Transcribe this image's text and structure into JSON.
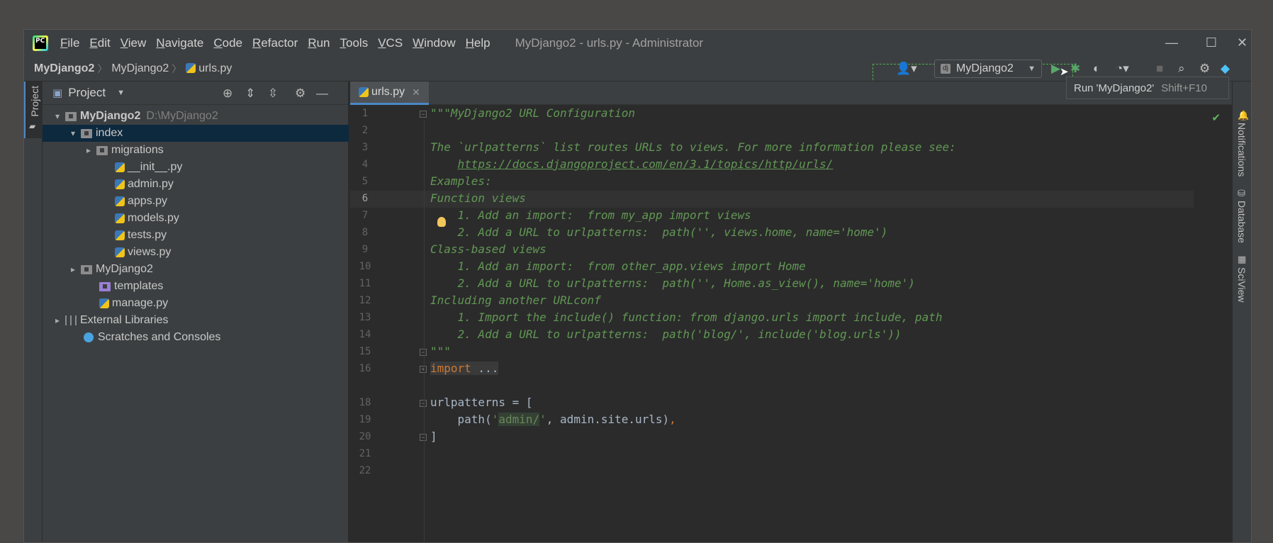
{
  "window": {
    "title": "MyDjango2 - urls.py - Administrator",
    "app_icon_text": "PC",
    "minimize_glyph": "—",
    "maximize_glyph": "☐",
    "close_glyph": "✕"
  },
  "menu": [
    {
      "u": "F",
      "rest": "ile"
    },
    {
      "u": "E",
      "rest": "dit"
    },
    {
      "u": "V",
      "rest": "iew"
    },
    {
      "u": "N",
      "rest": "avigate"
    },
    {
      "u": "C",
      "rest": "ode"
    },
    {
      "u": "R",
      "rest": "efactor"
    },
    {
      "u": "R",
      "rest": "un"
    },
    {
      "u": "T",
      "rest": "ools"
    },
    {
      "u": "V",
      "rest": "CS"
    },
    {
      "u": "W",
      "rest": "indow"
    },
    {
      "u": "H",
      "rest": "elp"
    }
  ],
  "breadcrumb": {
    "project": "MyDjango2",
    "package": "MyDjango2",
    "file": "urls.py"
  },
  "toolbar": {
    "run_config": "MyDjango2",
    "django_icon": "dj",
    "tooltip_label": "Run 'MyDjango2'",
    "tooltip_shortcut": "Shift+F10",
    "icons": [
      "user-icon",
      "run-icon",
      "debug-icon",
      "coverage-icon",
      "profile-icon",
      "stop-icon",
      "search-icon",
      "settings-icon",
      "jetbrains-icon"
    ]
  },
  "left_strip": {
    "project_tab": "Project"
  },
  "project_panel": {
    "title": "Project",
    "tree": [
      {
        "label": "MyDjango2",
        "path": "D:\\MyDjango2",
        "level": 0,
        "arrow": "▾",
        "icon": "folder-icon",
        "bold": true
      },
      {
        "label": "index",
        "level": 1,
        "arrow": "▾",
        "icon": "folder-icon",
        "selected": true
      },
      {
        "label": "migrations",
        "level": 2,
        "arrow": "▸",
        "icon": "folder-icon"
      },
      {
        "label": "__init__.py",
        "level": 3,
        "icon": "python-file-icon"
      },
      {
        "label": "admin.py",
        "level": 3,
        "icon": "python-file-icon"
      },
      {
        "label": "apps.py",
        "level": 3,
        "icon": "python-file-icon"
      },
      {
        "label": "models.py",
        "level": 3,
        "icon": "python-file-icon"
      },
      {
        "label": "tests.py",
        "level": 3,
        "icon": "python-file-icon"
      },
      {
        "label": "views.py",
        "level": 3,
        "icon": "python-file-icon"
      },
      {
        "label": "MyDjango2",
        "level": 1,
        "arrow": "▸",
        "icon": "folder-icon"
      },
      {
        "label": "templates",
        "level": 2,
        "icon": "template-folder-icon"
      },
      {
        "label": "manage.py",
        "level": 2,
        "icon": "python-file-icon"
      },
      {
        "label": "External Libraries",
        "level": 0,
        "arrow": "▸",
        "icon": "library-icon"
      },
      {
        "label": "Scratches and Consoles",
        "level": 1,
        "icon": "scratches-icon"
      }
    ]
  },
  "editor": {
    "tab_label": "urls.py",
    "tab_close": "✕",
    "current_line": "6",
    "line_numbers": [
      "1",
      "2",
      "3",
      "4",
      "5",
      "6",
      "7",
      "8",
      "9",
      "10",
      "11",
      "12",
      "13",
      "14",
      "15",
      "16",
      "18",
      "19",
      "20",
      "21",
      "22"
    ],
    "lines": {
      "l1": "\"\"\"MyDjango2 URL Configuration",
      "l3": "The `urlpatterns` list routes URLs to views. For more information please see:",
      "l4_indent": "    ",
      "l4_link": "https://docs.djangoproject.com/en/3.1/topics/http/urls/",
      "l5": "Examples:",
      "l6": "Function views",
      "l7": "    1. Add an import:  from my_app import views",
      "l8": "    2. Add a URL to urlpatterns:  path('', views.home, name='home')",
      "l9": "Class-based views",
      "l10": "    1. Add an import:  from other_app.views import Home",
      "l11": "    2. Add a URL to urlpatterns:  path('', Home.as_view(), name='home')",
      "l12": "Including another URLconf",
      "l13": "    1. Import the include() function: from django.urls import include, path",
      "l14": "    2. Add a URL to urlpatterns:  path('blog/', include('blog.urls'))",
      "l15": "\"\"\"",
      "l16_kw": "import",
      "l16_rest": " ...",
      "l19": "urlpatterns = [",
      "l20_a": "    path(",
      "l20_q1": "'",
      "l20_str": "admin/",
      "l20_q2": "'",
      "l20_b": ", admin.site.urls)",
      "l20_c": ",",
      "l21": "]"
    }
  },
  "right_strip": {
    "notifications": "Notifications",
    "database": "Database",
    "sciview": "SciView"
  },
  "colors": {
    "accent": "#4a88c7",
    "docstring": "#629755",
    "run_green": "#59a869",
    "selection": "#0d293e"
  }
}
